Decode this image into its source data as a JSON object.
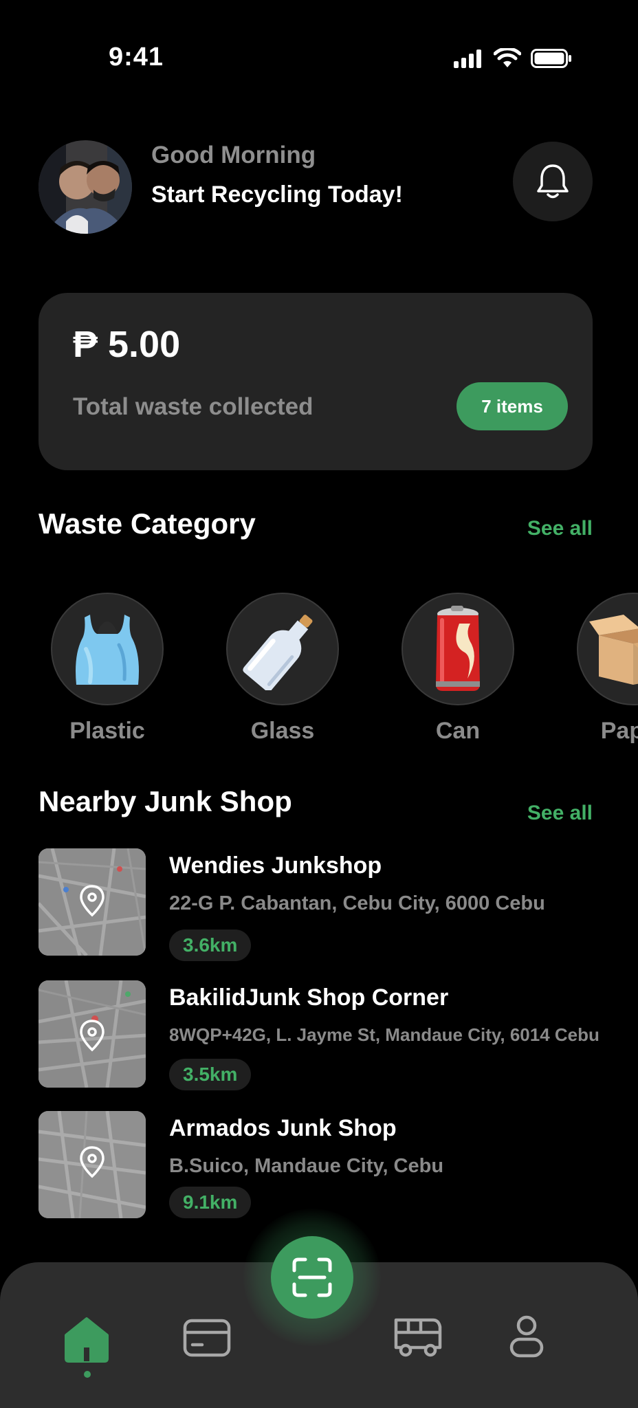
{
  "status_bar": {
    "time": "9:41",
    "icons": [
      "cellular-signal-icon",
      "wifi-icon",
      "battery-icon"
    ]
  },
  "header": {
    "greeting": "Good Morning",
    "subtitle": "Start Recycling Today!",
    "avatar_icon": "profile-photo",
    "notification_icon": "bell-icon"
  },
  "balance_card": {
    "amount": "₱ 5.00",
    "label": "Total waste collected",
    "badge": "7 items"
  },
  "waste_category": {
    "title": "Waste Category",
    "see_all": "See all",
    "items": [
      {
        "label": "Plastic",
        "icon": "plastic-bag-icon"
      },
      {
        "label": "Glass",
        "icon": "glass-bottle-icon"
      },
      {
        "label": "Can",
        "icon": "soda-can-icon"
      },
      {
        "label": "Paper",
        "icon": "cardboard-box-icon"
      }
    ]
  },
  "nearby": {
    "title": "Nearby Junk Shop",
    "see_all": "See all",
    "shops": [
      {
        "name": "Wendies Junkshop",
        "address": "22-G P. Cabantan, Cebu City, 6000 Cebu",
        "distance": "3.6km"
      },
      {
        "name": "BakilidJunk Shop Corner",
        "address": "8WQP+42G, L. Jayme St, Mandaue City, 6014 Cebu",
        "distance": "3.5km"
      },
      {
        "name": "Armados Junk Shop",
        "address": "B.Suico, Mandaue City, Cebu",
        "distance": "9.1km"
      }
    ]
  },
  "bottom_nav": {
    "items": [
      "home-icon",
      "wallet-card-icon",
      "scan-icon",
      "truck-icon",
      "profile-icon"
    ],
    "active": "home",
    "colors": {
      "accent": "#3d9b5e",
      "inactive": "#a8a8a8"
    }
  }
}
